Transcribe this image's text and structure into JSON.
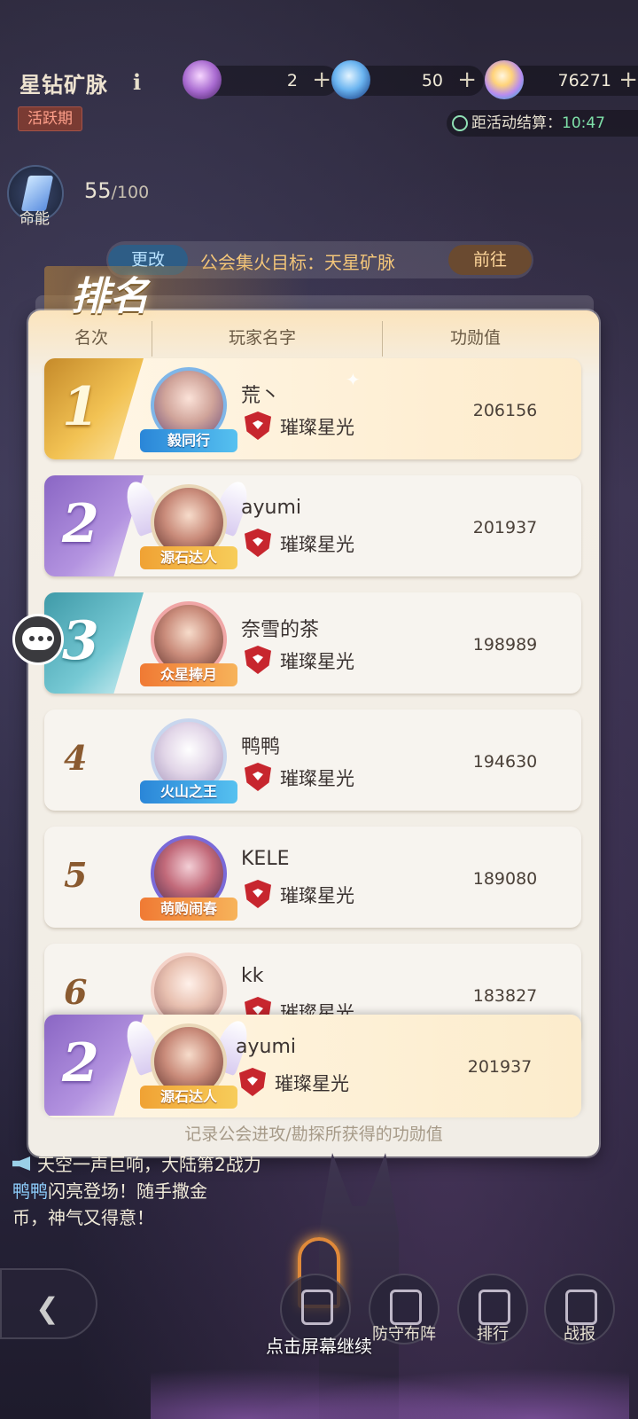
{
  "header": {
    "title": "星钻矿脉",
    "info_icon": "i",
    "resources": [
      {
        "icon": "purple-gem-icon",
        "value": "2",
        "plus": "+"
      },
      {
        "icon": "blue-gem-icon",
        "value": "50",
        "plus": "+"
      },
      {
        "icon": "rainbow-crystal-icon",
        "value": "76271",
        "plus": "+"
      }
    ],
    "status_badge": "活跃期",
    "countdown_label": "距活动结算：",
    "countdown_time": "10:47"
  },
  "energy": {
    "label": "命能",
    "current": "55",
    "max": "/100"
  },
  "goal": {
    "change_label": "更改",
    "text": "公会集火目标：天星矿脉",
    "goto_label": "前往"
  },
  "ranking": {
    "title": "排名",
    "columns": [
      "名次",
      "玩家名字",
      "功勋值"
    ],
    "rows": [
      {
        "rank": "1",
        "name": "荒丶",
        "guild": "璀璨星光",
        "score": "206156",
        "frame_tag": "毅同行"
      },
      {
        "rank": "2",
        "name": "ayumi",
        "guild": "璀璨星光",
        "score": "201937",
        "frame_tag": "源石达人"
      },
      {
        "rank": "3",
        "name": "奈雪的茶",
        "guild": "璀璨星光",
        "score": "198989",
        "frame_tag": "众星捧月"
      },
      {
        "rank": "4",
        "name": "鸭鸭",
        "guild": "璀璨星光",
        "score": "194630",
        "frame_tag": "火山之王"
      },
      {
        "rank": "5",
        "name": "KELE",
        "guild": "璀璨星光",
        "score": "189080",
        "frame_tag": "萌购闹春"
      },
      {
        "rank": "6",
        "name": "kk",
        "guild": "璀璨星光",
        "score": "183827",
        "frame_tag": ""
      }
    ],
    "mine": {
      "rank": "2",
      "name": "ayumi",
      "guild": "璀璨星光",
      "score": "201937",
      "frame_tag": "源石达人"
    },
    "footnote": "记录公会进攻/勘探所获得的功勋值"
  },
  "marquee": {
    "line1": "天空一声巨响，大陆第2战力",
    "highlight": "鸭鸭",
    "line2": "闪亮登场！随手撒金",
    "line3": "币，神气又得意！"
  },
  "bottom_nav": {
    "buttons": [
      {
        "icon": "sword-icon",
        "label": ""
      },
      {
        "icon": "shield-icon",
        "label": "防守布阵"
      },
      {
        "icon": "trophy-icon",
        "label": "排行"
      },
      {
        "icon": "battle-report-icon",
        "label": "战报"
      }
    ],
    "tap_hint": "点击屏幕继续"
  }
}
